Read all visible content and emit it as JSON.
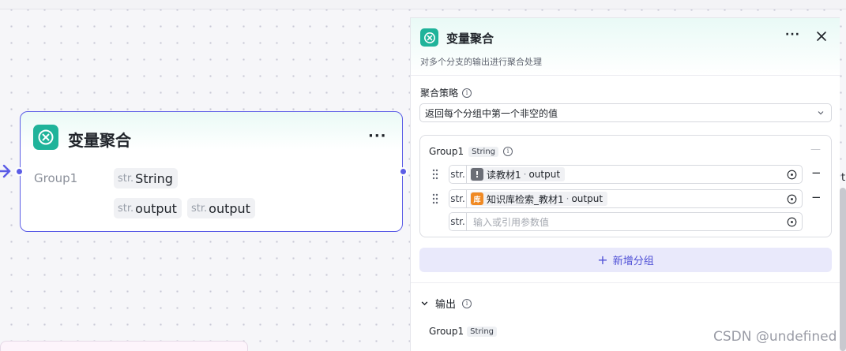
{
  "node": {
    "title": "变量聚合",
    "more": "···",
    "group_name": "Group1",
    "group_tag": {
      "prefix": "str.",
      "label": "String"
    },
    "value_tags": [
      {
        "prefix": "str.",
        "label": "output"
      },
      {
        "prefix": "str.",
        "label": "output"
      }
    ]
  },
  "panel": {
    "title": "变量聚合",
    "more": "···",
    "description": "对多个分支的输出进行聚合处理",
    "strategy": {
      "label": "聚合策略",
      "selected": "返回每个分组中第一个非空的值"
    },
    "group": {
      "name": "Group1",
      "type": "String",
      "dash": "—",
      "refs": [
        {
          "prefix": "str.",
          "source": "读教材1",
          "var": "output",
          "icon_color": "#6b6e76",
          "icon_glyph": "!"
        },
        {
          "prefix": "str.",
          "source": "知识库检索_教材1",
          "var": "output",
          "icon_color": "#f08a24",
          "icon_glyph": "库"
        }
      ],
      "empty_ref": {
        "prefix": "str.",
        "placeholder": "输入或引用参数值"
      },
      "minus": "−"
    },
    "add_group": {
      "plus": "+",
      "label": "新增分组"
    },
    "output": {
      "label": "输出",
      "group_name": "Group1",
      "type": "String"
    }
  },
  "edge_text": "t",
  "watermark": "CSDN @undefined",
  "colors": {
    "accent": "#5b5ce6",
    "node_icon": "#1fb39a",
    "add_button_bg": "#e9e9fb",
    "add_button_text": "#4e4fd6"
  },
  "icons": [
    "arrow-right-icon",
    "variable-aggregate-icon",
    "info-icon",
    "chevron-down-icon",
    "drag-handle-icon",
    "target-icon",
    "close-icon"
  ]
}
